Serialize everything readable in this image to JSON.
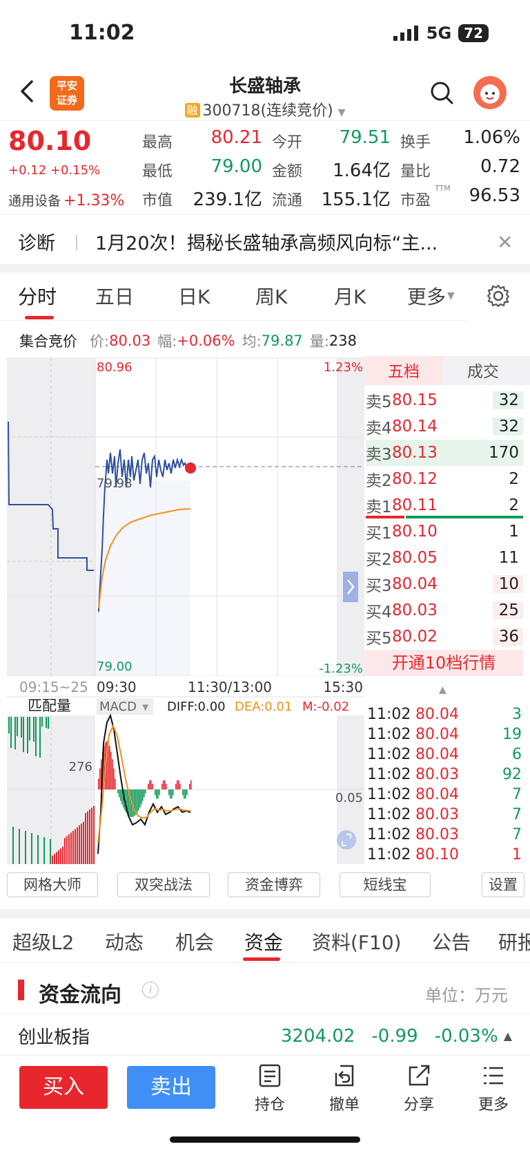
{
  "status": {
    "time": "11:02",
    "network": "5G",
    "battery": "72"
  },
  "header": {
    "logo_line1": "平安",
    "logo_line2": "证券",
    "title": "长盛轴承",
    "rong_badge": "融",
    "code": "300718(连续竞价)"
  },
  "quote": {
    "price": "80.10",
    "change": "+0.12 +0.15%",
    "sector": "通用设备",
    "sector_change": "+1.33%",
    "fields": [
      {
        "label": "最高",
        "value": "80.21"
      },
      {
        "label": "今开",
        "value": "79.51"
      },
      {
        "label": "换手",
        "value": "1.06%"
      },
      {
        "label": "最低",
        "value": "79.00"
      },
      {
        "label": "金额",
        "value": "1.64亿"
      },
      {
        "label": "量比",
        "value": "0.72"
      },
      {
        "label": "市值",
        "value": "239.1亿"
      },
      {
        "label": "流通",
        "value": "155.1亿"
      },
      {
        "label": "市盈",
        "value": "96.53"
      }
    ],
    "ttm": "TTM"
  },
  "diagnosis": {
    "label": "诊断",
    "text": "1月20次！揭秘长盛轴承高频风向标“主...",
    "close": "✕"
  },
  "period_tabs": [
    "分时",
    "五日",
    "日K",
    "周K",
    "月K",
    "更多"
  ],
  "auction": {
    "label": "集合竞价",
    "price_label": "价:",
    "price": "80.03",
    "amp_label": "幅:",
    "amp": "+0.06%",
    "avg_label": "均:",
    "avg": "79.87",
    "vol_label": "量:",
    "vol": "238"
  },
  "chart_labels": {
    "top_price": "80.96",
    "top_pct": "1.23%",
    "mid_price": "79.98",
    "bottom_price": "79.00",
    "bottom_pct": "-1.23%",
    "t_auction": "09:15~25",
    "t_open": "09:30",
    "t_mid": "11:30/13:00",
    "t_close": "15:30",
    "match_vol": "匹配量",
    "macd": "MACD",
    "diff": "DIFF:0.00",
    "dea": "DEA:0.01",
    "m": "M:-0.02",
    "vol_marker": "276",
    "macd_marker": "0.05"
  },
  "order_book": {
    "tabs": [
      "五档",
      "成交"
    ],
    "asks": [
      {
        "label": "卖5",
        "price": "80.15",
        "vol": "32"
      },
      {
        "label": "卖4",
        "price": "80.14",
        "vol": "32"
      },
      {
        "label": "卖3",
        "price": "80.13",
        "vol": "170"
      },
      {
        "label": "卖2",
        "price": "80.12",
        "vol": "2"
      },
      {
        "label": "卖1",
        "price": "80.11",
        "vol": "2"
      }
    ],
    "bids": [
      {
        "label": "买1",
        "price": "80.10",
        "vol": "1"
      },
      {
        "label": "买2",
        "price": "80.05",
        "vol": "11"
      },
      {
        "label": "买3",
        "price": "80.04",
        "vol": "10"
      },
      {
        "label": "买4",
        "price": "80.03",
        "vol": "25"
      },
      {
        "label": "买5",
        "price": "80.02",
        "vol": "36"
      }
    ],
    "open10": "开通10档行情"
  },
  "ticks": [
    {
      "time": "11:02",
      "price": "80.04",
      "vol": "3"
    },
    {
      "time": "11:02",
      "price": "80.04",
      "vol": "19"
    },
    {
      "time": "11:02",
      "price": "80.04",
      "vol": "6"
    },
    {
      "time": "11:02",
      "price": "80.03",
      "vol": "92"
    },
    {
      "time": "11:02",
      "price": "80.04",
      "vol": "7"
    },
    {
      "time": "11:02",
      "price": "80.03",
      "vol": "7"
    },
    {
      "time": "11:02",
      "price": "80.03",
      "vol": "7"
    },
    {
      "time": "11:02",
      "price": "80.10",
      "vol": "1"
    }
  ],
  "tools": [
    "网格大师",
    "双突战法",
    "资金博弈",
    "短线宝",
    "设置"
  ],
  "content_tabs": [
    "超级L2",
    "动态",
    "机会",
    "资金",
    "资料(F10)",
    "公告",
    "研报"
  ],
  "fund_flow": {
    "title": "资金流向",
    "info": "i",
    "unit": "单位：万元"
  },
  "index_row": {
    "name": "创业板指",
    "value": "3204.02",
    "change": "-0.99",
    "pct": "-0.03%"
  },
  "bottom": {
    "buy": "买入",
    "sell": "卖出",
    "hold": "持仓",
    "cancel": "撤单",
    "share": "分享",
    "more": "更多"
  },
  "colors": {
    "red": "#e8262e",
    "green": "#0f9b5b",
    "blue_line": "#2e4fa0",
    "avg_line": "#f0901e",
    "sell_btn": "#3f8ff7"
  }
}
